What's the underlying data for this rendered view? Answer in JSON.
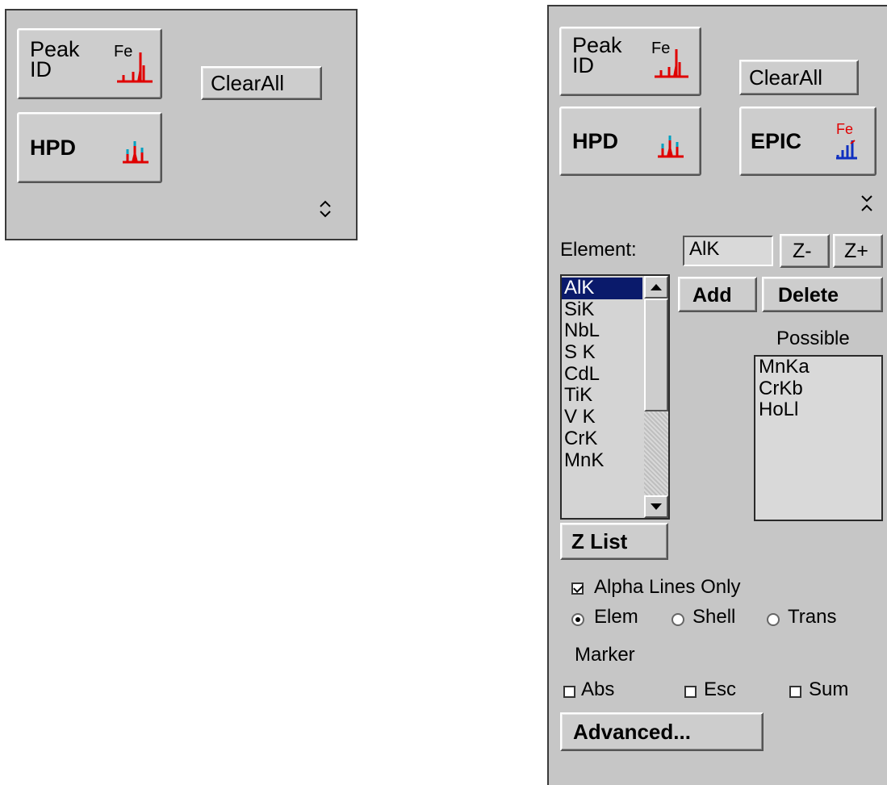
{
  "left_panel": {
    "peak_id_label_line1": "Peak",
    "peak_id_label_line2": "ID",
    "peak_id_icon_text": "Fe",
    "clear_all_label": "ClearAll",
    "hpd_label": "HPD",
    "collapse_toggle_glyph": "⌃⌄"
  },
  "right_panel": {
    "peak_id_label_line1": "Peak",
    "peak_id_label_line2": "ID",
    "peak_id_icon_text": "Fe",
    "clear_all_label": "ClearAll",
    "hpd_label": "HPD",
    "epic_label": "EPIC",
    "epic_icon_text": "Fe",
    "expand_toggle_glyph": "ᐟ",
    "element_label": "Element:",
    "element_value": "AlK",
    "z_minus_label": "Z-",
    "z_plus_label": "Z+",
    "add_label": "Add",
    "delete_label": "Delete",
    "possible_label": "Possible",
    "element_list": [
      "AlK",
      "SiK",
      "NbL",
      "S K",
      "CdL",
      "TiK",
      "V K",
      "CrK",
      "MnK"
    ],
    "possible_list": [
      "MnKa",
      "CrKb",
      "HoLl"
    ],
    "z_list_label": "Z List",
    "alpha_lines_label": "Alpha Lines Only",
    "radio_elem_label": "Elem",
    "radio_shell_label": "Shell",
    "radio_trans_label": "Trans",
    "marker_label": "Marker",
    "abs_label": "Abs",
    "esc_label": "Esc",
    "sum_label": "Sum",
    "advanced_label": "Advanced..."
  },
  "colors": {
    "panel_bg": "#c6c6c6",
    "selection_bg": "#0a1a6b",
    "peak_red": "#e00000",
    "peak_cyan": "#00a0c0",
    "epic_blue": "#1030c0"
  }
}
